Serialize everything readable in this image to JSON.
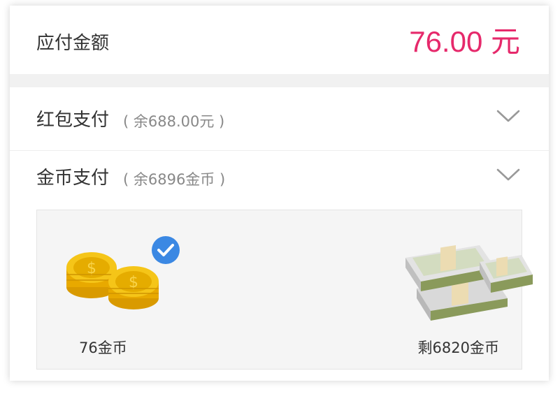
{
  "payment": {
    "amount_label": "应付金额",
    "amount_value": "76.00 元",
    "amount_color": "#e6296b"
  },
  "methods": [
    {
      "title": "红包支付",
      "balance_note": "( 余688.00元 )",
      "icon": "chevron-down-icon"
    },
    {
      "title": "金币支付",
      "balance_note": "( 余6896金币 )",
      "icon": "chevron-down-icon"
    }
  ],
  "coin_options": [
    {
      "label": "76金币",
      "icon": "gold-coins-icon",
      "selected": true
    },
    {
      "label": "剩6820金币",
      "icon": "cash-stack-icon",
      "selected": false
    }
  ],
  "colors": {
    "check_badge": "#3b88e3",
    "coin_gold": "#f2b705",
    "cash_green": "#8a9a5b"
  }
}
